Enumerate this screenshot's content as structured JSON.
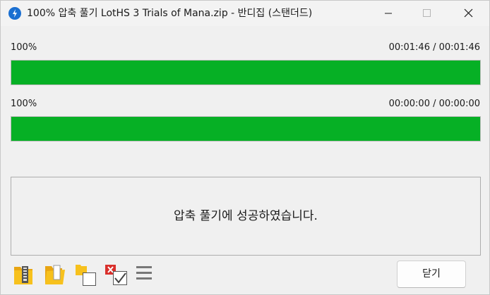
{
  "window": {
    "title": "100% 압축 풀기 LotHS 3 Trials of Mana.zip - 반디집 (스탠더드)",
    "icon": "bandizip-app-icon",
    "controls": [
      "minimize-icon",
      "maximize-icon",
      "close-icon"
    ]
  },
  "progress": [
    {
      "label": "100%",
      "time": "00:01:46 / 00:01:46",
      "fraction": 1.0
    },
    {
      "label": "100%",
      "time": "00:00:00 / 00:00:00",
      "fraction": 1.0
    }
  ],
  "message": "압축 풀기에 성공하였습니다.",
  "toolbar": {
    "icons": [
      "open-folder-zip-icon",
      "open-folder-icon",
      "copy-window-icon",
      "delete-archive-check-icon",
      "menu-icon"
    ]
  },
  "buttons": {
    "close_label": "닫기"
  },
  "colors": {
    "progress_fill": "#06b025",
    "accent": "#1a6fd1"
  }
}
